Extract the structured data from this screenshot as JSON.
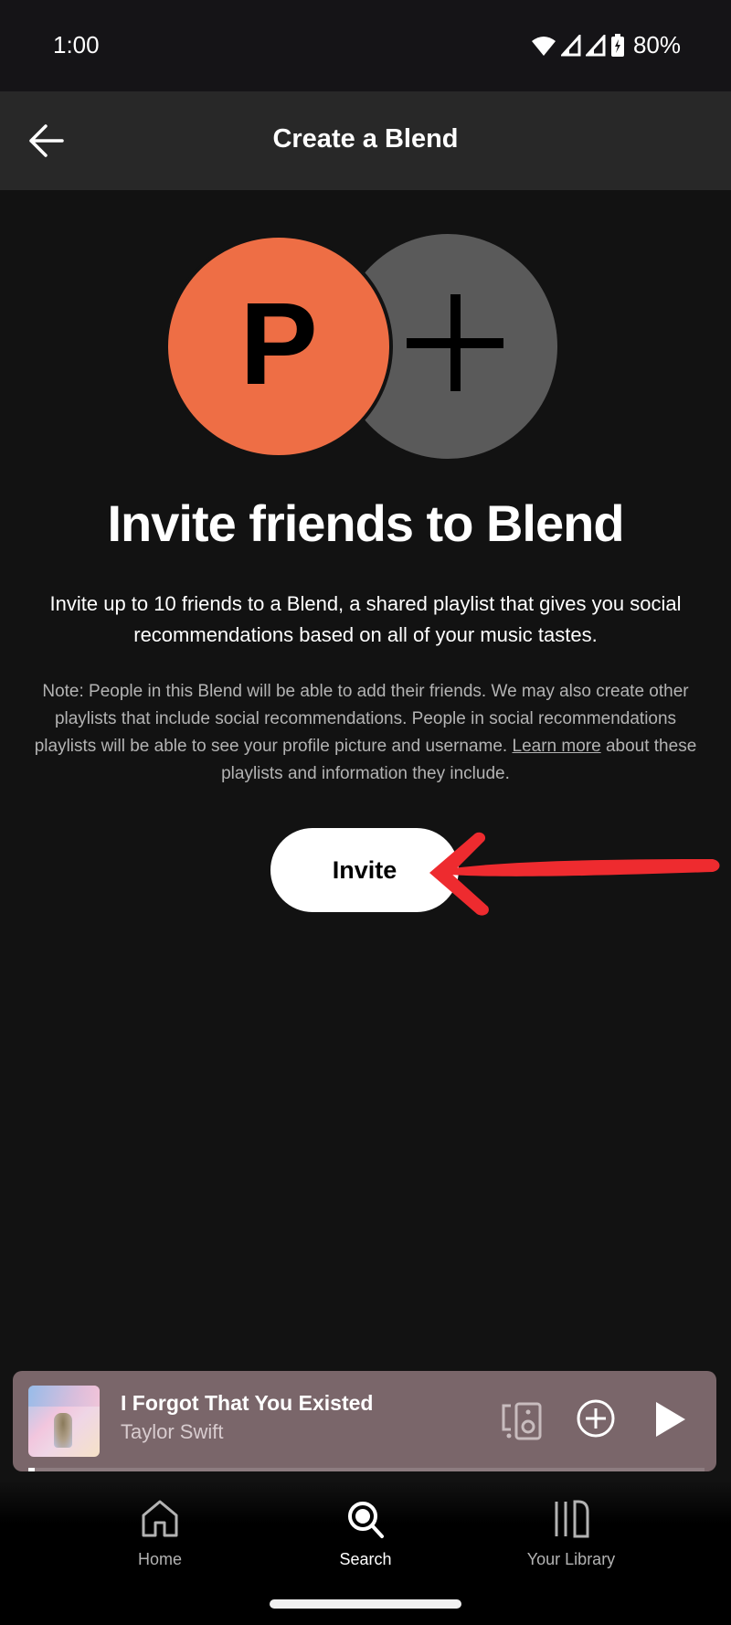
{
  "status_bar": {
    "time": "1:00",
    "battery_percent": "80%",
    "icons": [
      "wifi-icon",
      "signal-icon",
      "signal-icon",
      "battery-charging-icon"
    ]
  },
  "header": {
    "back_icon": "arrow-left-icon",
    "title": "Create a Blend"
  },
  "blend_graphic": {
    "user_initial": "P",
    "user_color": "#ee6e45",
    "add_color": "#5a5a5a",
    "add_icon": "plus-icon"
  },
  "content": {
    "headline": "Invite friends to Blend",
    "description": "Invite up to 10 friends to a Blend, a shared playlist that gives you social recommendations based on all of your music tastes.",
    "note_before_link": "Note: People in this Blend will be able to add their friends. We may also create other playlists that include social recommendations. People in social recommendations playlists will be able to see your profile picture and username. ",
    "note_link": "Learn more",
    "note_after_link": " about these playlists and information they include.",
    "invite_button": "Invite"
  },
  "annotation": {
    "type": "arrow",
    "color": "#ee2b2f",
    "points_to": "invite-button"
  },
  "now_playing": {
    "title": "I Forgot That You Existed",
    "artist": "Taylor Swift",
    "progress": 0.01,
    "background_color": "#7a666a",
    "controls": [
      "devices-icon",
      "add-circle-icon",
      "play-icon"
    ]
  },
  "bottom_nav": {
    "items": [
      {
        "label": "Home",
        "icon": "home-icon",
        "active": false
      },
      {
        "label": "Search",
        "icon": "search-icon",
        "active": true
      },
      {
        "label": "Your Library",
        "icon": "library-icon",
        "active": false
      }
    ]
  }
}
